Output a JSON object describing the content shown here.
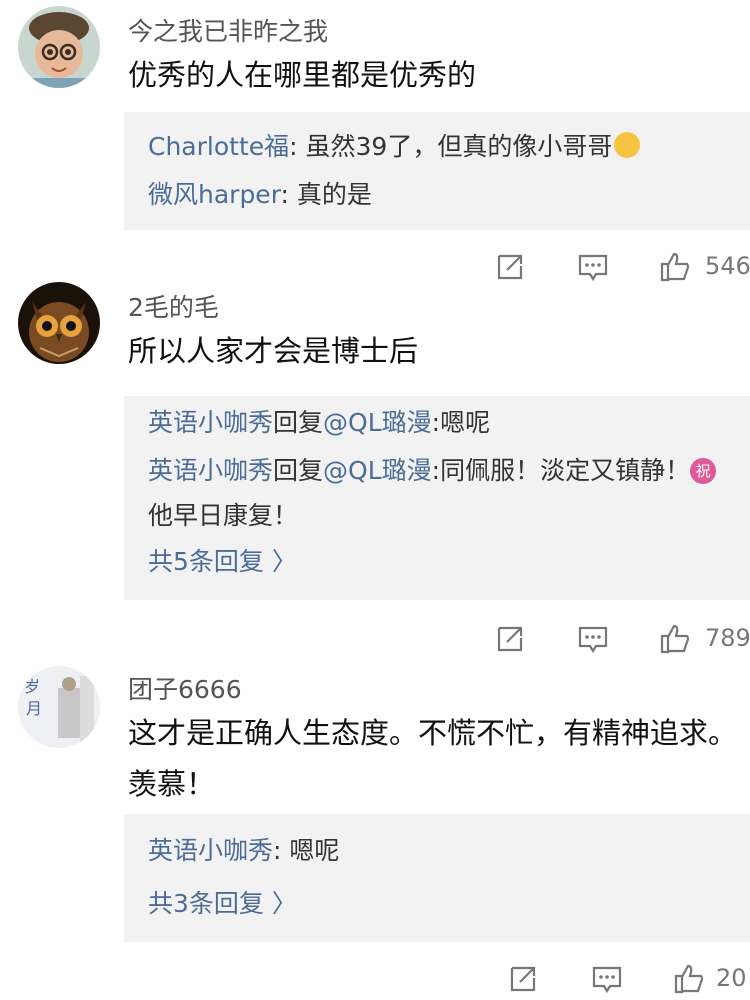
{
  "comments": [
    {
      "username": "今之我已非昨之我",
      "content": "优秀的人在哪里都是优秀的",
      "replies": [
        {
          "user": "Charlotte福",
          "sep": ": ",
          "text": "虽然39了，但真的像小哥哥"
        },
        {
          "user": "微风harper",
          "sep": ": ",
          "text": "真的是"
        }
      ],
      "likes": "546"
    },
    {
      "username": "2毛的毛",
      "content": "所以人家才会是博士后",
      "replies": [
        {
          "user": "英语小咖秀",
          "mid": "回复",
          "target": "@QL璐漫",
          "sep": ":",
          "text": "嗯呢"
        },
        {
          "user": "英语小咖秀",
          "mid": "回复",
          "target": "@QL璐漫",
          "sep": ":",
          "text": "同佩服！淡定又镇静！",
          "badge": "祝",
          "text2": "他早日康复！"
        }
      ],
      "more": "共5条回复 〉",
      "likes": "789"
    },
    {
      "username": "团子6666",
      "content": "这才是正确人生态度。不慌不忙，有精神追求。羡慕！",
      "replies": [
        {
          "user": "英语小咖秀",
          "sep": ": ",
          "text": "嗯呢"
        }
      ],
      "more": "共3条回复 〉",
      "likes": "20"
    }
  ],
  "icons": {
    "repost": "share-icon",
    "reply": "comment-icon",
    "like": "thumbs-up-icon"
  }
}
